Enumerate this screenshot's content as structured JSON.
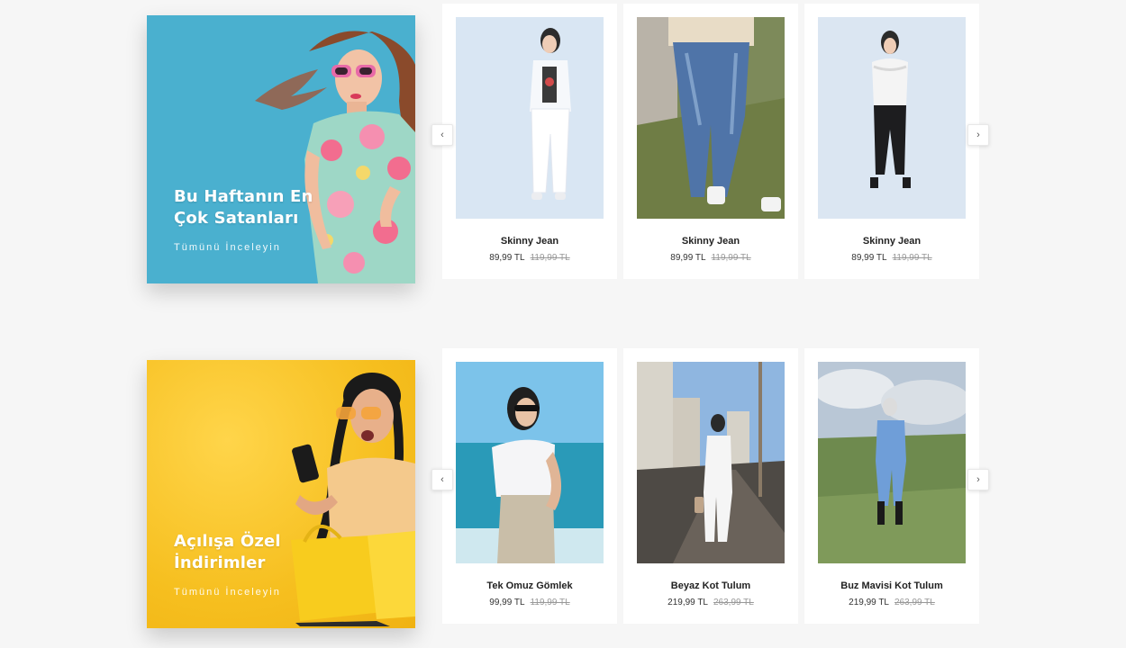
{
  "sections": [
    {
      "promo": {
        "title": "Bu Haftanın En Çok Satanları",
        "link": "Tümünü İnceleyin",
        "bg_color": "#4ab0cf"
      },
      "nav": {
        "prev": "‹",
        "next": "›"
      },
      "products": [
        {
          "name": "Skinny Jean",
          "price": "89,99 TL",
          "old_price": "119,99 TL"
        },
        {
          "name": "Skinny Jean",
          "price": "89,99 TL",
          "old_price": "119,99 TL"
        },
        {
          "name": "Skinny Jean",
          "price": "89,99 TL",
          "old_price": "119,99 TL"
        }
      ]
    },
    {
      "promo": {
        "title": "Açılışa Özel İndirimler",
        "link": "Tümünü İnceleyin",
        "bg_color": "#f6bf1f"
      },
      "nav": {
        "prev": "‹",
        "next": "›"
      },
      "products": [
        {
          "name": "Tek Omuz Gömlek",
          "price": "99,99 TL",
          "old_price": "119,99 TL"
        },
        {
          "name": "Beyaz Kot Tulum",
          "price": "219,99 TL",
          "old_price": "263,99 TL"
        },
        {
          "name": "Buz Mavisi Kot Tulum",
          "price": "219,99 TL",
          "old_price": "263,99 TL"
        }
      ]
    }
  ]
}
